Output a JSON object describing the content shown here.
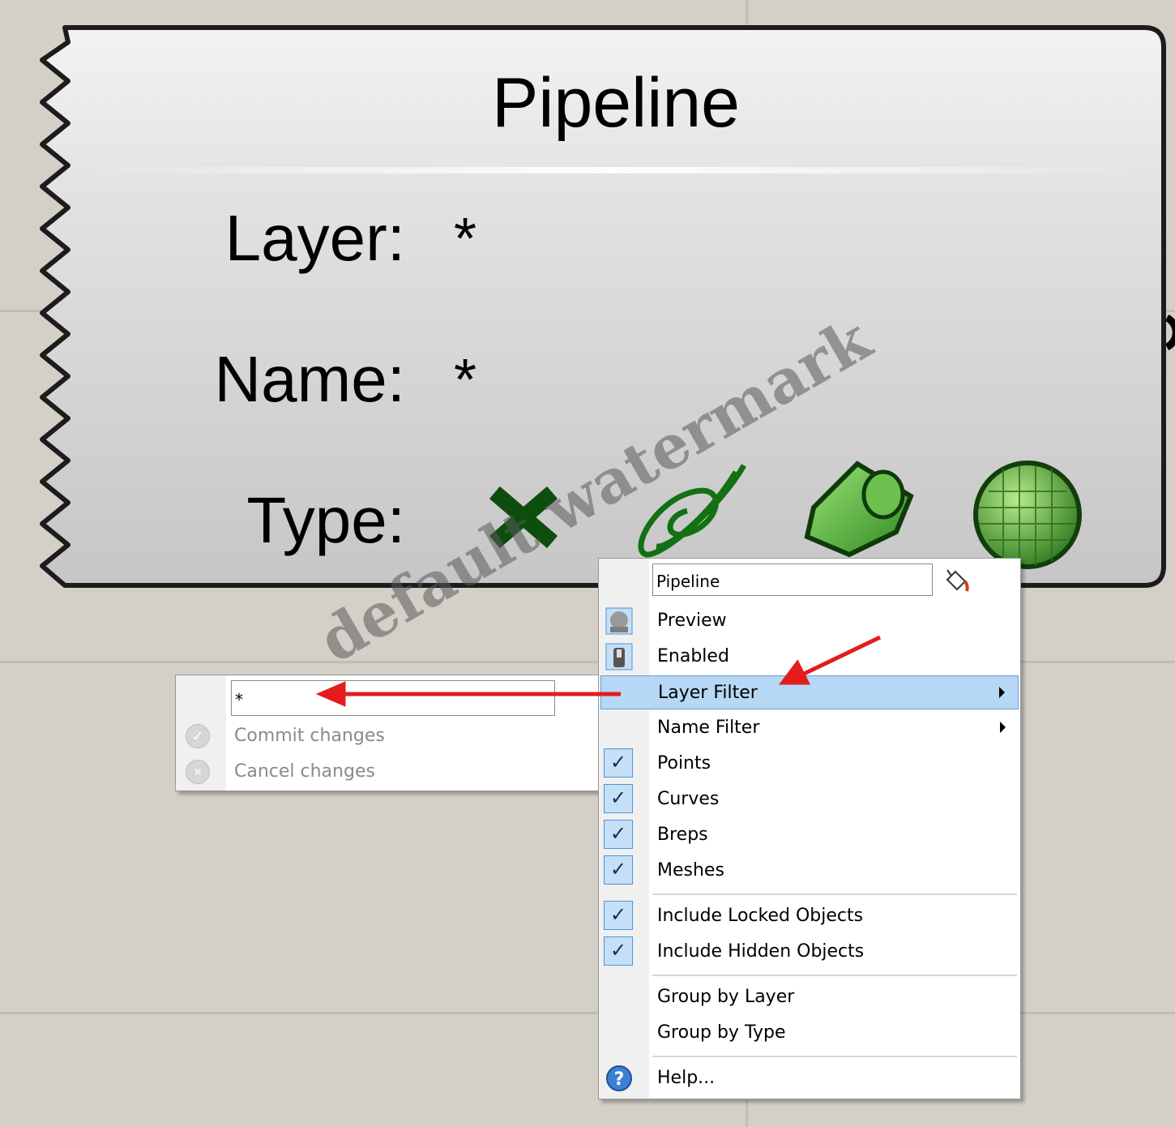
{
  "component": {
    "title": "Pipeline",
    "fields": [
      {
        "label": "Layer:",
        "value": "*"
      },
      {
        "label": "Name:",
        "value": "*"
      },
      {
        "label": "Type:"
      }
    ],
    "type_icons": [
      "point-icon",
      "curve-icon",
      "brep-icon",
      "mesh-icon"
    ]
  },
  "context_menu": {
    "name_value": "Pipeline",
    "items": {
      "preview": "Preview",
      "enabled": "Enabled",
      "layer_filter": "Layer Filter",
      "name_filter": "Name Filter",
      "points": "Points",
      "curves": "Curves",
      "breps": "Breps",
      "meshes": "Meshes",
      "include_locked": "Include Locked Objects",
      "include_hidden": "Include Hidden Objects",
      "group_by_layer": "Group by Layer",
      "group_by_type": "Group by Type",
      "help": "Help..."
    },
    "check_mark": "✓",
    "highlight_color": "#b7d8f5"
  },
  "layer_submenu": {
    "filter_value": "*",
    "commit": "Commit changes",
    "cancel": "Cancel changes"
  },
  "annotation_color": "#e51c1c",
  "watermark": "default watermark"
}
